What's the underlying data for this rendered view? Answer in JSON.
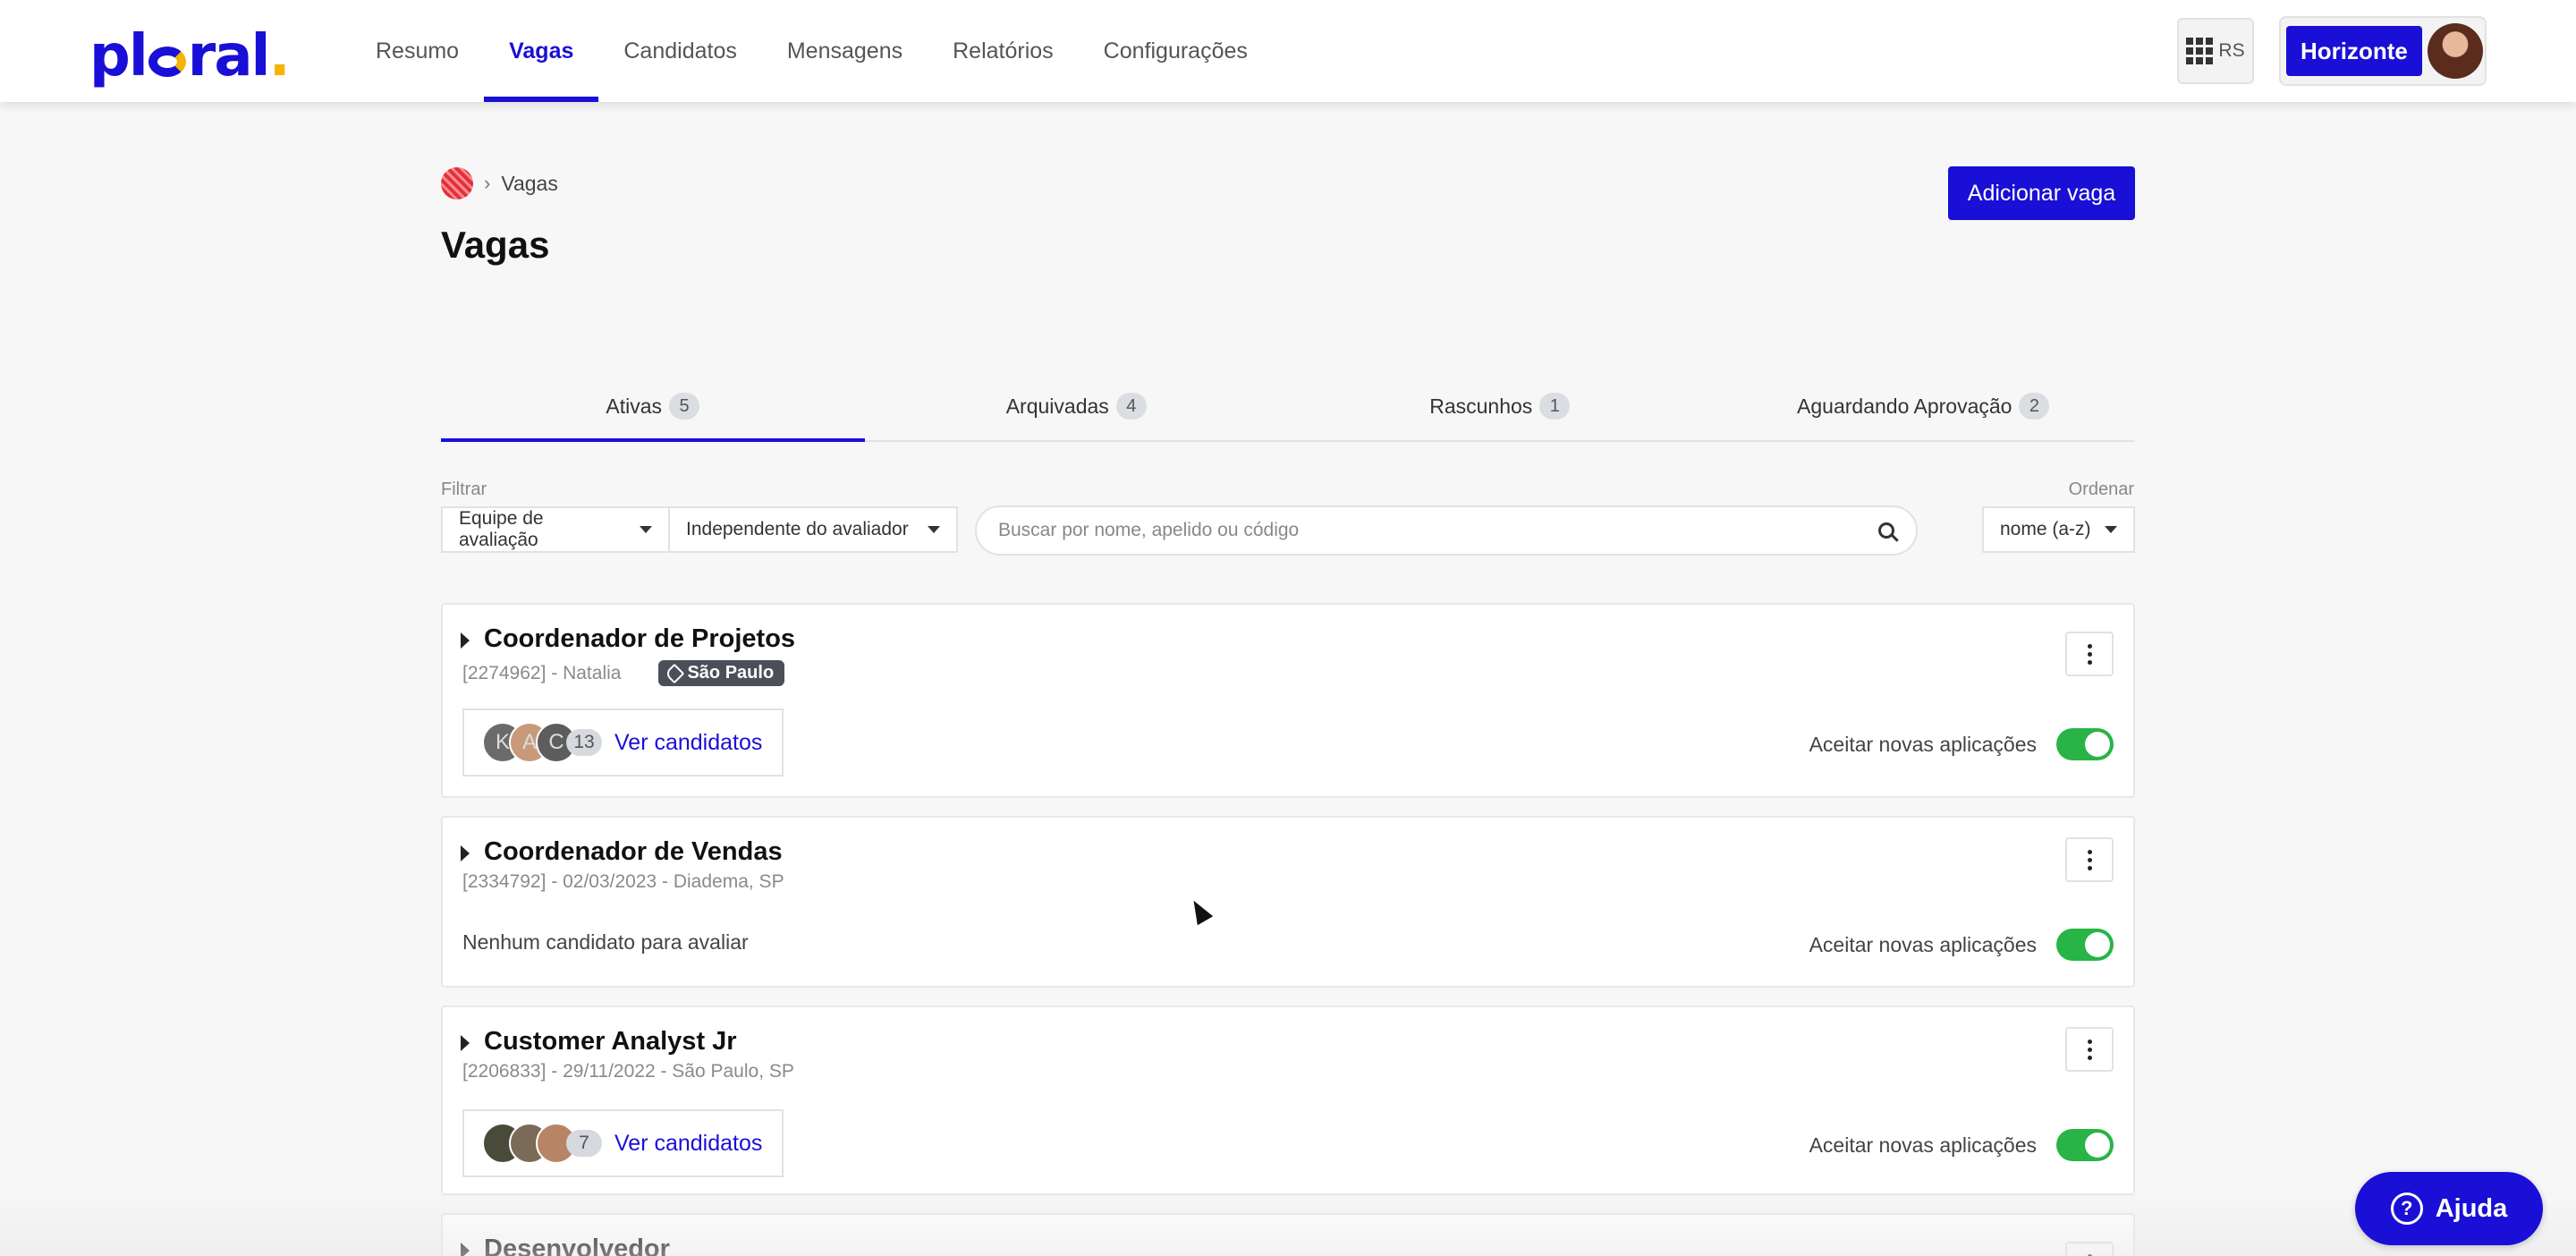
{
  "app": {
    "logo_text": "plural",
    "nav": [
      {
        "label": "Resumo"
      },
      {
        "label": "Vagas"
      },
      {
        "label": "Candidatos"
      },
      {
        "label": "Mensagens"
      },
      {
        "label": "Relatórios"
      },
      {
        "label": "Configurações"
      }
    ],
    "active_nav": "Vagas",
    "apps_button": {
      "icon": "grid-icon",
      "label": "RS"
    },
    "account": {
      "org": "Horizonte"
    }
  },
  "breadcrumb": {
    "current": "Vagas"
  },
  "page_title": "Vagas",
  "add_button": "Adicionar vaga",
  "tabs": [
    {
      "label": "Ativas",
      "count": "5"
    },
    {
      "label": "Arquivadas",
      "count": "4"
    },
    {
      "label": "Rascunhos",
      "count": "1"
    },
    {
      "label": "Aguardando Aprovação",
      "count": "2"
    }
  ],
  "filters": {
    "filter_label": "Filtrar",
    "team_select": "Equipe de avaliação",
    "evaluator_select": "Independente do avaliador",
    "search_placeholder": "Buscar por nome, apelido ou código",
    "order_label": "Ordenar",
    "order_select": "nome (a-z)"
  },
  "jobs": [
    {
      "title": "Coordenador de Projetos",
      "meta": "[2274962] - Natalia",
      "tag": "São Paulo",
      "avatars": [
        "K",
        "A",
        "C"
      ],
      "candidate_count": "13",
      "candidates_link": "Ver candidatos",
      "accept_label": "Aceitar novas aplicações",
      "accepting": true
    },
    {
      "title": "Coordenador de Vendas",
      "meta": "[2334792] - 02/03/2023 - Diadema, SP",
      "no_candidates": "Nenhum candidato para avaliar",
      "accept_label": "Aceitar novas aplicações",
      "accepting": true
    },
    {
      "title": "Customer Analyst Jr",
      "meta": "[2206833] - 29/11/2022 - São Paulo, SP",
      "candidate_count": "7",
      "candidates_link": "Ver candidatos",
      "accept_label": "Aceitar novas aplicações",
      "accepting": true
    },
    {
      "title": "Desenvolvedor"
    }
  ],
  "help_button": "Ajuda",
  "colors": {
    "brand": "#1a0fd6",
    "accent": "#f5b400",
    "toggle_on": "#28b446"
  }
}
